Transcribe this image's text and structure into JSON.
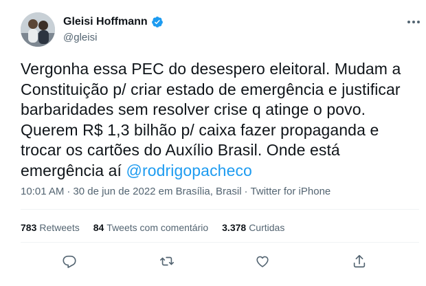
{
  "author": {
    "name": "Gleisi Hoffmann",
    "handle": "@gleisi",
    "verified": true,
    "avatar_icon": "profile-photo"
  },
  "tweet": {
    "lines": [
      "Vergonha essa PEC do desespero eleitoral. Mudam a",
      "Constituição p/ criar estado de emergência e justificar",
      "barbaridades sem resolver crise q atinge o povo.",
      "Querem R$ 1,3 bilhão p/ caixa fazer propaganda e",
      "trocar os cartões do Auxílio Brasil. Onde está"
    ],
    "last_line_text": "emergência aí ",
    "mention": "@rodrigopacheco"
  },
  "meta": {
    "time": "10:01 AM",
    "date": "30 de jun de 2022 em Brasília, Brasil",
    "source": "Twitter for iPhone"
  },
  "stats": {
    "retweets_count": "783",
    "retweets_label": "Retweets",
    "quotes_count": "84",
    "quotes_label": "Tweets com comentário",
    "likes_count": "3.378",
    "likes_label": "Curtidas"
  },
  "actions": [
    "reply-icon",
    "retweet-icon",
    "like-icon",
    "share-icon"
  ],
  "colors": {
    "accent": "#1d9bf0",
    "text": "#0f1419",
    "secondary": "#536471",
    "divider": "#eff3f4"
  }
}
